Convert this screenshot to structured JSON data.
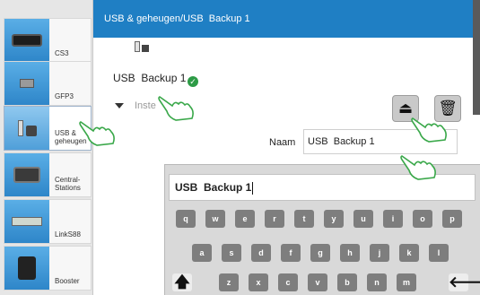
{
  "header": {
    "title": "USB & geheugen/USB  Backup 1"
  },
  "sidebar": {
    "items": [
      {
        "label": "CS3",
        "icon": "cs3-device-icon"
      },
      {
        "label": "GFP3",
        "icon": "gfp3-device-icon"
      },
      {
        "label": "USB & geheugen",
        "icon": "usb-device-icon",
        "active": true
      },
      {
        "label": "Central-Stations",
        "icon": "central-station-icon"
      },
      {
        "label": "LinkS88",
        "icon": "links88-device-icon"
      },
      {
        "label": "Booster",
        "icon": "booster-device-icon"
      }
    ]
  },
  "device": {
    "name": "USB  Backup 1",
    "status": "ok"
  },
  "settings": {
    "label": "Inste"
  },
  "actions": {
    "eject_icon": "⏏",
    "trash_icon": "🗑"
  },
  "form": {
    "name_label": "Naam",
    "name_value": "USB  Backup 1"
  },
  "keyboard": {
    "input_value": "USB  Backup 1",
    "row1": [
      "q",
      "w",
      "e",
      "r",
      "t",
      "y",
      "u",
      "i",
      "o",
      "p"
    ],
    "row2": [
      "a",
      "s",
      "d",
      "f",
      "g",
      "h",
      "j",
      "k",
      "l"
    ],
    "row3": [
      "z",
      "x",
      "c",
      "v",
      "b",
      "n",
      "m"
    ],
    "shift_icon": "🡅",
    "backspace_icon": "🡐"
  },
  "colors": {
    "header": "#1f7fc4",
    "accent": "#2d9b46",
    "gesture": "#3aa84a"
  }
}
